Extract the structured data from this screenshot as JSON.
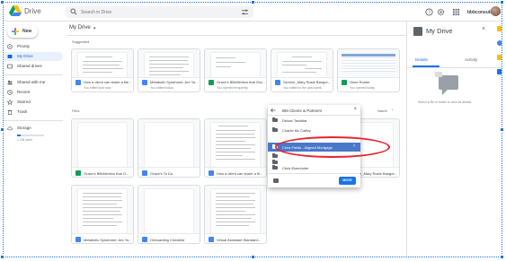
{
  "app": {
    "title": "Drive",
    "brand": "bbbconsultants"
  },
  "search": {
    "placeholder": "Search in Drive"
  },
  "sidebar": {
    "new_label": "New",
    "items": [
      {
        "label": "Priority",
        "icon": "priority-icon"
      },
      {
        "label": "My Drive",
        "icon": "my-drive-icon",
        "active": true
      },
      {
        "label": "Shared drives",
        "icon": "shared-drives-icon"
      },
      {
        "label": "Shared with me",
        "icon": "shared-with-me-icon"
      },
      {
        "label": "Recent",
        "icon": "recent-icon"
      },
      {
        "label": "Starred",
        "icon": "star-icon"
      },
      {
        "label": "Trash",
        "icon": "trash-icon"
      }
    ],
    "storage_label": "Storage",
    "storage_used": "1 GB used",
    "storage_fraction": 0.12
  },
  "main": {
    "path_title": "My Drive",
    "suggested_label": "Suggested",
    "files_label": "Files",
    "sort_label": "Name",
    "suggested": [
      {
        "name": "How a client can share a file...",
        "sub": "You edited just now",
        "kind": "doc"
      },
      {
        "name": "Metabolic Syndrome: Are Yo...",
        "sub": "You edited today",
        "kind": "doc"
      },
      {
        "name": "Grace's BBxMetrics that Gra...",
        "sub": "You opened frequently",
        "kind": "sheet"
      },
      {
        "name": "Service_Mary Rosie Bangor...",
        "sub": "You edited in the past week",
        "kind": "doc"
      },
      {
        "name": "Store Roster",
        "sub": "You opened today",
        "kind": "sheet"
      }
    ],
    "files": [
      {
        "name": "Grace's BBxMetrics that G...",
        "kind": "sheet"
      },
      {
        "name": "Grace's To Do",
        "kind": "doc"
      },
      {
        "name": "How a client can share a fil...",
        "kind": "doc"
      },
      {
        "name": "Service_Mary Rosie Bangor...",
        "kind": "doc"
      },
      {
        "name": "Metabolic Syndrome: Are Yo...",
        "kind": "doc"
      },
      {
        "name": "Onboarding Checklist",
        "kind": "doc"
      },
      {
        "name": "Virtual Assistant Standard...",
        "kind": "doc"
      }
    ]
  },
  "move_dialog": {
    "title": "BM Clients & Partners",
    "folders": [
      {
        "label": "Deloar Tarafdar"
      },
      {
        "label": "Charlie Mc Caffey"
      },
      {
        "label": "Chris Fields - Aligned Mortgage",
        "selected": true
      },
      {
        "label": ""
      },
      {
        "label": ""
      },
      {
        "label": "Chris Eizenhofer"
      }
    ],
    "move_label": "MOVE"
  },
  "details": {
    "title": "My Drive",
    "tabs": [
      "Details",
      "Activity"
    ],
    "empty_message": "Select a file or folder to view its details"
  },
  "colors": {
    "accent": "#1a73e8",
    "highlight": "#e8232d",
    "selected_row": "#4a78c9"
  }
}
